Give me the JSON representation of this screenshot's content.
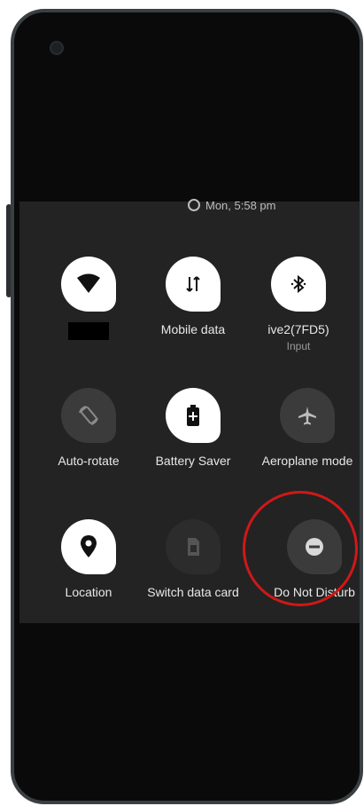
{
  "status": {
    "time": "Mon, 5:58 pm"
  },
  "tiles": [
    {
      "label": "",
      "sublabel": "",
      "icon": "wifi-icon",
      "state": "on"
    },
    {
      "label": "Mobile data",
      "sublabel": "",
      "icon": "mobile-data-icon",
      "state": "on"
    },
    {
      "label": "ive2(7FD5)",
      "sublabel": "Input",
      "icon": "bluetooth-icon",
      "state": "on"
    },
    {
      "label": "Auto-rotate",
      "sublabel": "",
      "icon": "auto-rotate-icon",
      "state": "off"
    },
    {
      "label": "Battery Saver",
      "sublabel": "",
      "icon": "battery-saver-icon",
      "state": "on"
    },
    {
      "label": "Aeroplane mode",
      "sublabel": "",
      "icon": "airplane-icon",
      "state": "off"
    },
    {
      "label": "Location",
      "sublabel": "",
      "icon": "location-icon",
      "state": "on"
    },
    {
      "label": "Switch data card",
      "sublabel": "",
      "icon": "sim-card-icon",
      "state": "disabled"
    },
    {
      "label": "Do Not Disturb",
      "sublabel": "",
      "icon": "do-not-disturb-icon",
      "state": "off"
    }
  ],
  "colors": {
    "tile_on": "#ffffff",
    "tile_off": "#3b3b3b",
    "panel": "#232323",
    "highlight": "#d01818"
  }
}
